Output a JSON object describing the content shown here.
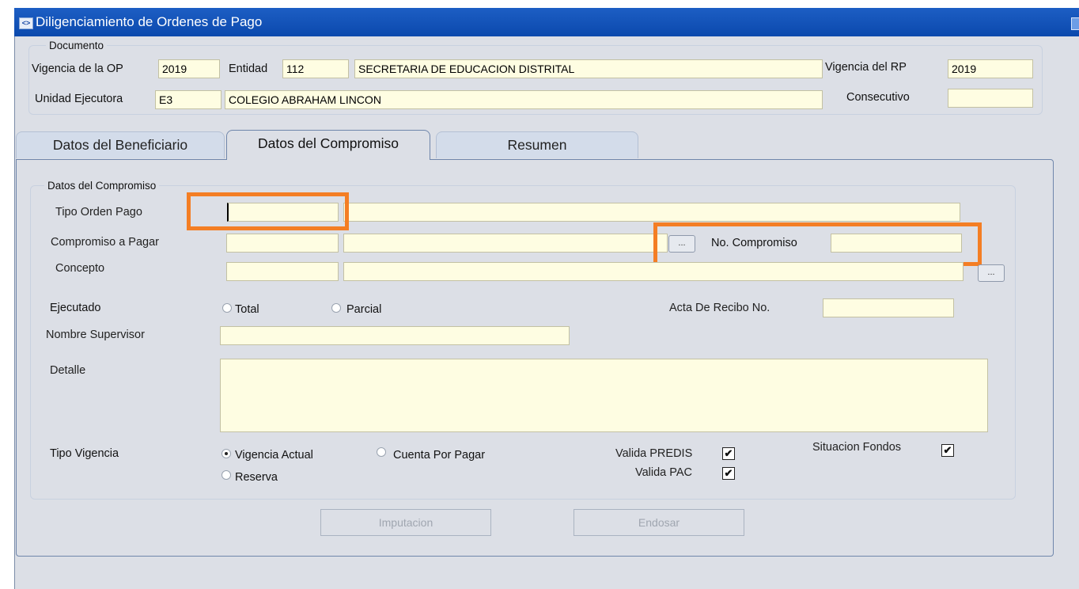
{
  "window": {
    "title": "Diligenciamiento de Ordenes de Pago"
  },
  "documento": {
    "group_title": "Documento",
    "vigencia_op_label": "Vigencia de la OP",
    "vigencia_op_value": "2019",
    "entidad_label": "Entidad",
    "entidad_code": "112",
    "entidad_name": "SECRETARIA DE EDUCACION DISTRITAL",
    "vigencia_rp_label": "Vigencia del RP",
    "vigencia_rp_value": "2019",
    "unidad_label": "Unidad Ejecutora",
    "unidad_code": "E3",
    "unidad_name": "COLEGIO ABRAHAM LINCON",
    "consecutivo_label": "Consecutivo",
    "consecutivo_value": ""
  },
  "tabs": [
    {
      "label": "Datos del Beneficiario",
      "active": false
    },
    {
      "label": "Datos del Compromiso",
      "active": true
    },
    {
      "label": "Resumen",
      "active": false
    }
  ],
  "compromiso": {
    "group_title": "Datos del Compromiso",
    "tipo_orden_label": "Tipo Orden Pago",
    "tipo_orden_code": "",
    "tipo_orden_desc": "",
    "compromiso_label": "Compromiso a Pagar",
    "compromiso_code": "",
    "compromiso_desc": "",
    "lov_button": "...",
    "no_compromiso_label": "No. Compromiso",
    "no_compromiso_value": "",
    "concepto_label": "Concepto",
    "concepto_code": "",
    "concepto_desc": "",
    "ejecutado_label": "Ejecutado",
    "ejecutado_options": [
      "Total",
      "Parcial"
    ],
    "acta_label": "Acta De Recibo No.",
    "acta_value": "",
    "supervisor_label": "Nombre Supervisor",
    "supervisor_value": "",
    "detalle_label": "Detalle",
    "detalle_value": "",
    "tipo_vigencia_label": "Tipo Vigencia",
    "tipo_vigencia_options": [
      "Vigencia Actual",
      "Cuenta Por Pagar",
      "Reserva"
    ],
    "tipo_vigencia_selected": "Vigencia Actual",
    "valida_predis_label": "Valida PREDIS",
    "valida_predis_checked": true,
    "valida_pac_label": "Valida PAC",
    "valida_pac_checked": true,
    "situacion_fondos_label": "Situacion Fondos",
    "situacion_fondos_checked": true
  },
  "buttons": {
    "imputacion": "Imputacion",
    "endosar": "Endosar"
  },
  "colors": {
    "titlebar": "#0b49ad",
    "field_bg": "#fefde2",
    "highlight": "#f47e24",
    "panel_bg": "#dcdfe6"
  }
}
